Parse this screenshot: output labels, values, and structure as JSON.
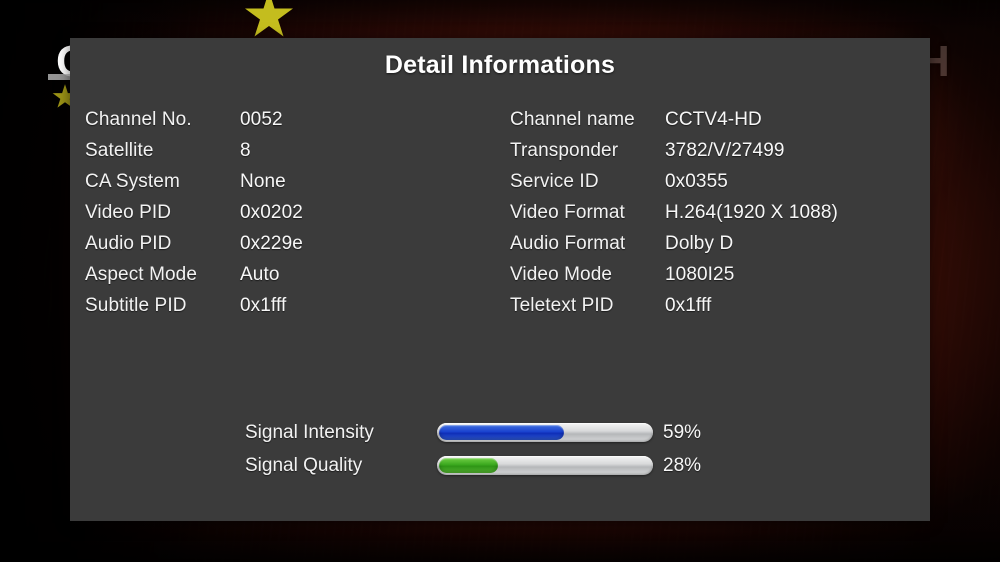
{
  "background": {
    "description": "dark red tv picture with yellow star",
    "edge_glyph_left": "C",
    "edge_glyph_right": "H",
    "colors": {
      "base": "#6b1c0d",
      "star": "#cfc820",
      "panel": "#3b3b3b"
    }
  },
  "dialog": {
    "title": "Detail Informations",
    "columns": {
      "left": [
        {
          "label": "Channel No.",
          "value": "0052"
        },
        {
          "label": "Satellite",
          "value": "8"
        },
        {
          "label": "CA System",
          "value": "None"
        },
        {
          "label": "Video PID",
          "value": "0x0202"
        },
        {
          "label": "Audio PID",
          "value": "0x229e"
        },
        {
          "label": "Aspect Mode",
          "value": "Auto"
        },
        {
          "label": "Subtitle PID",
          "value": "0x1fff"
        }
      ],
      "right": [
        {
          "label": "Channel name",
          "value": "CCTV4-HD"
        },
        {
          "label": "Transponder",
          "value": "3782/V/27499"
        },
        {
          "label": "Service ID",
          "value": "0x0355"
        },
        {
          "label": "Video Format",
          "value": "H.264(1920 X 1088)"
        },
        {
          "label": "Audio Format",
          "value": "Dolby D"
        },
        {
          "label": "Video Mode",
          "value": "1080I25"
        },
        {
          "label": "Teletext PID",
          "value": "0x1fff"
        }
      ]
    },
    "signals": [
      {
        "label": "Signal Intensity",
        "percent_text": "59%",
        "percent": 59,
        "color": "#1a42cf"
      },
      {
        "label": "Signal Quality",
        "percent_text": "28%",
        "percent": 28,
        "color": "#3aa81e"
      }
    ]
  }
}
